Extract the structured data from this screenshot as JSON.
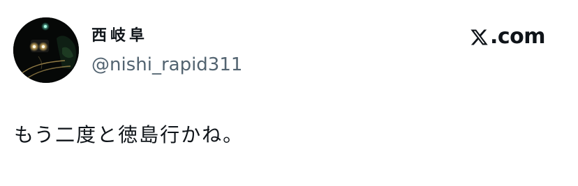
{
  "post": {
    "author": {
      "display_name": "西岐阜",
      "handle": "@nishi_rapid311",
      "avatar_icon": "night-train-avatar-icon"
    },
    "brand": {
      "logo_icon": "x-logo-icon",
      "domain": ".com"
    },
    "text": "もう二度と徳島行かね。"
  },
  "colors": {
    "text_primary": "#0f1419",
    "text_secondary": "#536471",
    "background": "#ffffff"
  }
}
